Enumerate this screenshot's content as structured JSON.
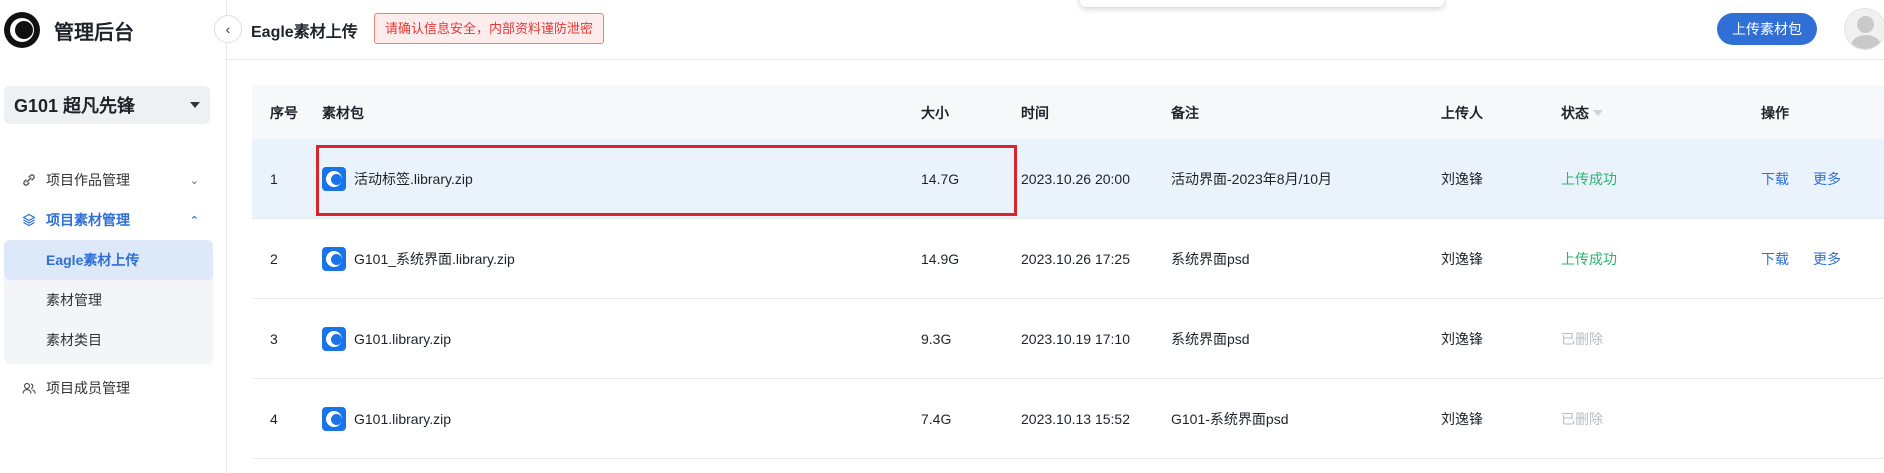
{
  "app": {
    "title": "管理后台"
  },
  "sidebar": {
    "project": "G101 超凡先锋",
    "items": [
      {
        "label": "项目作品管理",
        "icon": "link-icon",
        "expanded": false
      },
      {
        "label": "项目素材管理",
        "icon": "layers-icon",
        "expanded": true,
        "children": [
          {
            "label": "Eagle素材上传",
            "active": true
          },
          {
            "label": "素材管理"
          },
          {
            "label": "素材类目"
          }
        ]
      },
      {
        "label": "项目成员管理",
        "icon": "members-icon"
      }
    ]
  },
  "header": {
    "title": "Eagle素材上传",
    "warning": "请确认信息安全，内部资料谨防泄密",
    "upload_label": "上传素材包"
  },
  "table": {
    "columns": [
      "序号",
      "素材包",
      "大小",
      "时间",
      "备注",
      "上传人",
      "状态",
      "操作"
    ],
    "rows": [
      {
        "idx": "1",
        "name": "活动标签.library.zip",
        "size": "14.7G",
        "time": "2023.10.26 20:00",
        "note": "活动界面-2023年8月/10月",
        "user": "刘逸锋",
        "status": "上传成功",
        "status_type": "ok",
        "ops": [
          "下载",
          "更多"
        ]
      },
      {
        "idx": "2",
        "name": "G101_系统界面.library.zip",
        "size": "14.9G",
        "time": "2023.10.26 17:25",
        "note": "系统界面psd",
        "user": "刘逸锋",
        "status": "上传成功",
        "status_type": "ok",
        "ops": [
          "下载",
          "更多"
        ]
      },
      {
        "idx": "3",
        "name": "G101.library.zip",
        "size": "9.3G",
        "time": "2023.10.19 17:10",
        "note": "系统界面psd",
        "user": "刘逸锋",
        "status": "已删除",
        "status_type": "deleted",
        "ops": []
      },
      {
        "idx": "4",
        "name": "G101.library.zip",
        "size": "7.4G",
        "time": "2023.10.13 15:52",
        "note": "G101-系统界面psd",
        "user": "刘逸锋",
        "status": "已删除",
        "status_type": "deleted",
        "ops": []
      }
    ]
  },
  "colors": {
    "accent": "#2f6fd6",
    "success": "#2bb56f",
    "danger": "#d9262b",
    "muted": "#b8bcc4"
  }
}
